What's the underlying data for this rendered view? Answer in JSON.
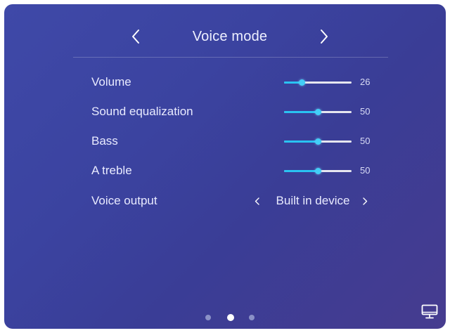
{
  "header": {
    "title": "Voice mode",
    "prev_icon": "chevron-left-icon",
    "next_icon": "chevron-right-icon"
  },
  "settings": [
    {
      "label": "Volume",
      "value": "26",
      "level": 0.26
    },
    {
      "label": "Sound equalization",
      "value": "50",
      "level": 0.5
    },
    {
      "label": "Bass",
      "value": "50",
      "level": 0.5
    },
    {
      "label": "A treble",
      "value": "50",
      "level": 0.5
    }
  ],
  "voice_output": {
    "label": "Voice output",
    "value": "Built in device",
    "prev_icon": "chevron-left-icon",
    "next_icon": "chevron-right-icon"
  },
  "pagination": {
    "count": 3,
    "active_index": 1
  },
  "footer": {
    "icon": "monitor-icon"
  },
  "colors": {
    "slider_fill": "#29c3f2",
    "slider_track": "#e6e6ef",
    "knob": "#43cef7",
    "background_start": "#3f49a8",
    "background_end": "#463c8f"
  }
}
